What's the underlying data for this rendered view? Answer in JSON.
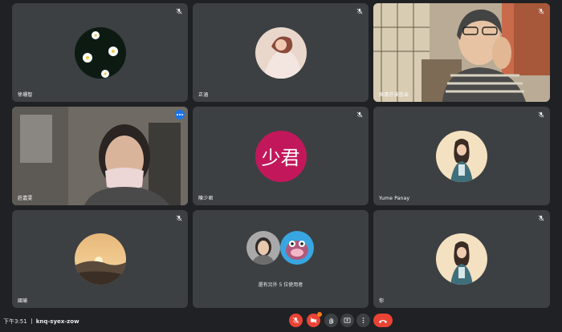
{
  "tiles": [
    {
      "name": "徐珊智",
      "muted": true,
      "avatar": "daisy-flowers-avatar"
    },
    {
      "name": "正涵",
      "muted": true,
      "avatar": "person-photo-avatar"
    },
    {
      "name": "陳惠芬溪信出",
      "muted": true,
      "avatar": "video-feed-woman"
    },
    {
      "name": "莊嘉雯",
      "muted": false,
      "avatar": "video-feed-masked-woman"
    },
    {
      "name": "陳少君",
      "muted": true,
      "initials": "少君",
      "initials_color": "#c2185b"
    },
    {
      "name": "Yume Panay",
      "muted": true,
      "avatar": "illustration-girl-avatar"
    },
    {
      "name": "國瑜",
      "muted": true,
      "avatar": "sunset-avatar"
    },
    {
      "name": "",
      "muted": false,
      "extra_label": "還有另外 5 位使用者"
    },
    {
      "name": "你",
      "muted": true,
      "avatar": "illustration-girl-avatar"
    }
  ],
  "bottombar": {
    "time": "下午3:51",
    "meeting_code": "knq-syex-zow"
  },
  "colors": {
    "background": "#202124",
    "tile": "#3c4043",
    "end_call": "#ea4335",
    "active_border": "#8ab4f8"
  }
}
